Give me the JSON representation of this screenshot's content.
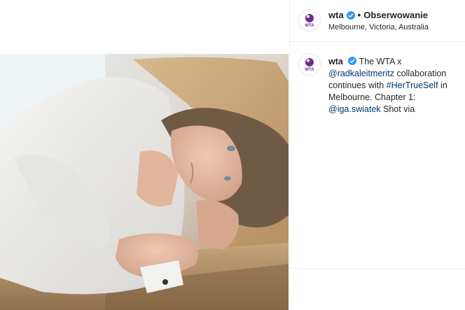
{
  "post": {
    "username": "wta",
    "follow_status": "Obserwowanie",
    "separator": "•",
    "location": "Melbourne, Victoria, Australia",
    "logo_text": "WTA"
  },
  "caption": {
    "username": "wta",
    "text_1": "The WTA x ",
    "mention_1": "@radkaleitmeritz",
    "text_2": " collaboration continues with ",
    "hashtag_1": "#HerTrueSelf",
    "text_3": " in Melbourne. Chapter 1: ",
    "mention_2": "@iga.swiatek",
    "text_4": " Shot via"
  },
  "colors": {
    "verified": "#3897f0",
    "link": "#00376b",
    "logo_purple": "#6a2c91"
  }
}
